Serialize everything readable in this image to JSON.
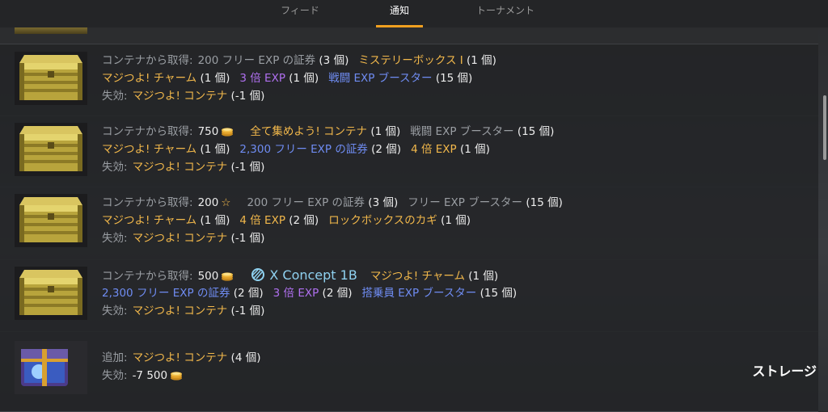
{
  "tabs": [
    {
      "label": "フィード",
      "active": false
    },
    {
      "label": "通知",
      "active": true
    },
    {
      "label": "トーナメント",
      "active": false
    }
  ],
  "colors": {
    "accent": "#f0a020",
    "gold": "#f2b84b",
    "purple": "#b070f0",
    "blue": "#6f8cf2",
    "gray": "#9a9ea3"
  },
  "rows": [
    {
      "lines": [
        {
          "label": "コンテナから取得:",
          "segments": [
            {
              "text": "200 フリー EXP の証券",
              "qty": "(3 個)",
              "color": "gray"
            },
            {
              "text": "ミステリーボックス I",
              "qty": "(1 個)",
              "color": "gold"
            }
          ]
        },
        {
          "segments": [
            {
              "text": "マジつよ! チャーム",
              "qty": "(1 個)",
              "color": "gold"
            },
            {
              "text": "3 倍 EXP",
              "qty": "(1 個)",
              "color": "purple"
            },
            {
              "text": "戦闘 EXP ブースター",
              "qty": "(15 個)",
              "color": "blue"
            }
          ]
        },
        {
          "label": "失効:",
          "segments": [
            {
              "text": "マジつよ! コンテナ",
              "qty": "(-1 個)",
              "color": "gold"
            }
          ]
        }
      ]
    },
    {
      "lines": [
        {
          "label": "コンテナから取得:",
          "amount": "750",
          "currency": "coin-icon",
          "segments": [
            {
              "text": "全て集めよう! コンテナ",
              "qty": "(1 個)",
              "color": "gold"
            },
            {
              "text": "戦闘 EXP ブースター",
              "qty": "(15 個)",
              "color": "gray"
            }
          ]
        },
        {
          "segments": [
            {
              "text": "マジつよ! チャーム",
              "qty": "(1 個)",
              "color": "gold"
            },
            {
              "text": "2,300 フリー EXP の証券",
              "qty": "(2 個)",
              "color": "blue"
            },
            {
              "text": "4 倍 EXP",
              "qty": "(1 個)",
              "color": "gold"
            }
          ]
        },
        {
          "label": "失効:",
          "segments": [
            {
              "text": "マジつよ! コンテナ",
              "qty": "(-1 個)",
              "color": "gold"
            }
          ]
        }
      ]
    },
    {
      "lines": [
        {
          "label": "コンテナから取得:",
          "amount": "200",
          "currency": "star-icon",
          "segments": [
            {
              "text": "200 フリー EXP の証券",
              "qty": "(3 個)",
              "color": "gray"
            },
            {
              "text": "フリー EXP ブースター",
              "qty": "(15 個)",
              "color": "gray"
            }
          ]
        },
        {
          "segments": [
            {
              "text": "マジつよ! チャーム",
              "qty": "(1 個)",
              "color": "gold"
            },
            {
              "text": "4 倍 EXP",
              "qty": "(2 個)",
              "color": "gold"
            },
            {
              "text": "ロックボックスのカギ",
              "qty": "(1 個)",
              "color": "gold"
            }
          ]
        },
        {
          "label": "失効:",
          "segments": [
            {
              "text": "マジつよ! コンテナ",
              "qty": "(-1 個)",
              "color": "gold"
            }
          ]
        }
      ]
    },
    {
      "lines": [
        {
          "label": "コンテナから取得:",
          "amount": "500",
          "currency": "coin-icon",
          "tank": "X Concept 1B",
          "segments": [
            {
              "text": "マジつよ! チャーム",
              "qty": "(1 個)",
              "color": "gold"
            }
          ]
        },
        {
          "segments": [
            {
              "text": "2,300 フリー EXP の証券",
              "qty": "(2 個)",
              "color": "blue"
            },
            {
              "text": "3 倍 EXP",
              "qty": "(2 個)",
              "color": "purple"
            },
            {
              "text": "搭乗員 EXP ブースター",
              "qty": "(15 個)",
              "color": "blue"
            }
          ]
        },
        {
          "label": "失効:",
          "segments": [
            {
              "text": "マジつよ! コンテナ",
              "qty": "(-1 個)",
              "color": "gold"
            }
          ]
        }
      ]
    },
    {
      "lines": [
        {
          "label": "追加:",
          "segments": [
            {
              "text": "マジつよ! コンテナ",
              "qty": "(4 個)",
              "color": "gold"
            }
          ]
        },
        {
          "label": "失効:",
          "amount": "-7 500",
          "currency": "coin-icon",
          "segments": []
        }
      ],
      "action": "ストレージ"
    }
  ]
}
